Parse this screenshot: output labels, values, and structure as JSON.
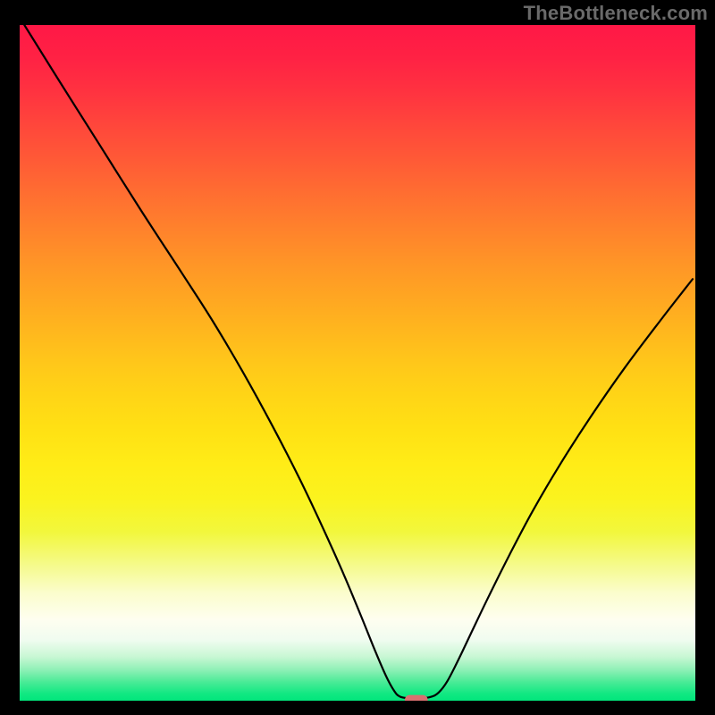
{
  "watermark": "TheBottleneck.com",
  "chart_data": {
    "type": "line",
    "title": "",
    "xlabel": "",
    "ylabel": "",
    "xlim": [
      0,
      100
    ],
    "ylim": [
      0,
      100
    ],
    "grid": false,
    "background_gradient": {
      "stops": [
        {
          "offset": 0.0,
          "color": "#ff1846"
        },
        {
          "offset": 0.05,
          "color": "#ff2244"
        },
        {
          "offset": 0.1,
          "color": "#ff3340"
        },
        {
          "offset": 0.15,
          "color": "#ff473b"
        },
        {
          "offset": 0.2,
          "color": "#ff5a36"
        },
        {
          "offset": 0.25,
          "color": "#ff6e31"
        },
        {
          "offset": 0.3,
          "color": "#ff812c"
        },
        {
          "offset": 0.35,
          "color": "#ff9427"
        },
        {
          "offset": 0.4,
          "color": "#ffa522"
        },
        {
          "offset": 0.45,
          "color": "#ffb61e"
        },
        {
          "offset": 0.5,
          "color": "#ffc71a"
        },
        {
          "offset": 0.55,
          "color": "#ffd516"
        },
        {
          "offset": 0.6,
          "color": "#ffe114"
        },
        {
          "offset": 0.65,
          "color": "#ffec17"
        },
        {
          "offset": 0.7,
          "color": "#fbf31e"
        },
        {
          "offset": 0.75,
          "color": "#f2f73c"
        },
        {
          "offset": 0.8,
          "color": "#f5fa8c"
        },
        {
          "offset": 0.84,
          "color": "#fbfdcc"
        },
        {
          "offset": 0.88,
          "color": "#fefef0"
        },
        {
          "offset": 0.91,
          "color": "#f0fcf0"
        },
        {
          "offset": 0.935,
          "color": "#c8f7d4"
        },
        {
          "offset": 0.955,
          "color": "#8cf0b5"
        },
        {
          "offset": 0.972,
          "color": "#4beb97"
        },
        {
          "offset": 0.99,
          "color": "#10e882"
        },
        {
          "offset": 1.0,
          "color": "#02e67c"
        }
      ]
    },
    "series": [
      {
        "name": "curve",
        "type": "line",
        "color": "#000000",
        "width": 2.2,
        "points": [
          {
            "x": 0.7,
            "y": 100.0
          },
          {
            "x": 6.0,
            "y": 91.5
          },
          {
            "x": 12.0,
            "y": 82.0
          },
          {
            "x": 18.0,
            "y": 72.5
          },
          {
            "x": 24.0,
            "y": 63.3
          },
          {
            "x": 28.5,
            "y": 56.3
          },
          {
            "x": 33.0,
            "y": 48.7
          },
          {
            "x": 37.5,
            "y": 40.5
          },
          {
            "x": 41.5,
            "y": 32.7
          },
          {
            "x": 45.0,
            "y": 25.3
          },
          {
            "x": 48.0,
            "y": 18.6
          },
          {
            "x": 50.5,
            "y": 12.6
          },
          {
            "x": 52.6,
            "y": 7.4
          },
          {
            "x": 54.2,
            "y": 3.7
          },
          {
            "x": 55.4,
            "y": 1.5
          },
          {
            "x": 56.3,
            "y": 0.6
          },
          {
            "x": 57.8,
            "y": 0.35
          },
          {
            "x": 59.3,
            "y": 0.35
          },
          {
            "x": 60.8,
            "y": 0.55
          },
          {
            "x": 62.0,
            "y": 1.2
          },
          {
            "x": 63.3,
            "y": 2.9
          },
          {
            "x": 65.0,
            "y": 6.2
          },
          {
            "x": 67.0,
            "y": 10.4
          },
          {
            "x": 69.5,
            "y": 15.6
          },
          {
            "x": 72.5,
            "y": 21.6
          },
          {
            "x": 76.0,
            "y": 28.2
          },
          {
            "x": 80.0,
            "y": 35.0
          },
          {
            "x": 84.5,
            "y": 42.0
          },
          {
            "x": 89.5,
            "y": 49.2
          },
          {
            "x": 95.0,
            "y": 56.5
          },
          {
            "x": 99.6,
            "y": 62.4
          }
        ]
      }
    ],
    "marker": {
      "name": "optimal-point",
      "shape": "rounded-rect",
      "x": 58.7,
      "y": 0.1,
      "w": 3.4,
      "h": 1.5,
      "color": "#d97070"
    }
  }
}
